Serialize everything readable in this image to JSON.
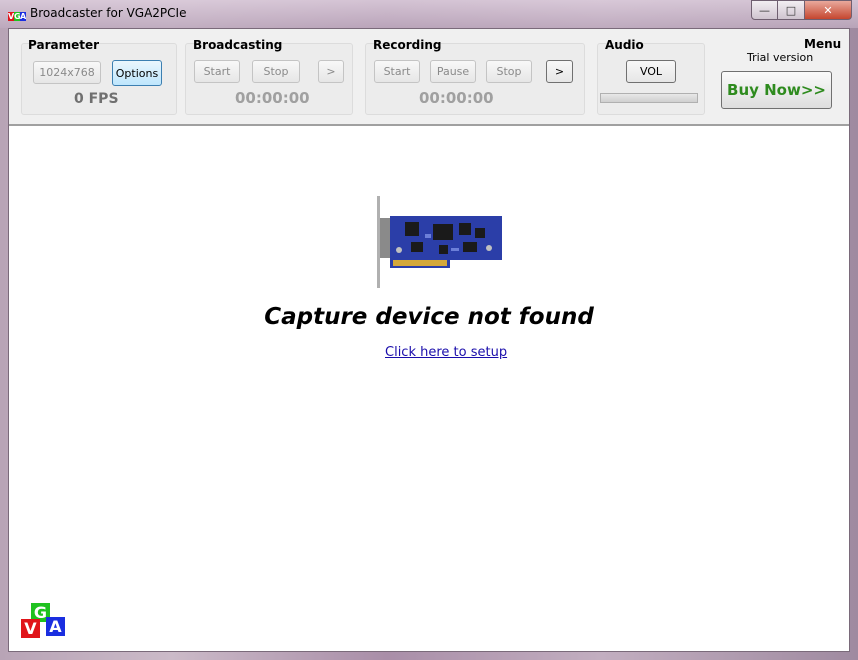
{
  "window": {
    "title": "Broadcaster for VGA2PCIe",
    "app_icon_letters": [
      "V",
      "G",
      "A"
    ]
  },
  "parameter": {
    "title": "Parameter",
    "resolution_label": "1024x768",
    "options_label": "Options",
    "fps": "0 FPS"
  },
  "broadcasting": {
    "title": "Broadcasting",
    "start_label": "Start",
    "stop_label": "Stop",
    "more_label": ">",
    "time": "00:00:00"
  },
  "recording": {
    "title": "Recording",
    "start_label": "Start",
    "pause_label": "Pause",
    "stop_label": "Stop",
    "more_label": ">",
    "time": "00:00:00"
  },
  "audio": {
    "title": "Audio",
    "vol_label": "VOL"
  },
  "menu": {
    "title": "Menu",
    "trial_text": "Trial version",
    "buy_label": "Buy Now>>"
  },
  "main": {
    "status_message": "Capture device not found",
    "setup_link": "Click here to setup"
  },
  "logo": {
    "letters": [
      "G",
      "V",
      "A"
    ]
  },
  "colors": {
    "buy_text": "#2e8b1e",
    "link": "#1a0dab",
    "logo_g": "#1fc21f",
    "logo_v": "#e0141a",
    "logo_a": "#1a2ee0"
  }
}
